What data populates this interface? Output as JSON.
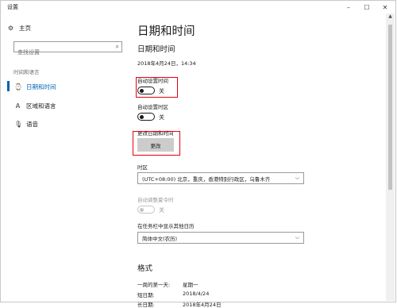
{
  "window": {
    "title": "设置",
    "minimize": "–",
    "maximize": "☐",
    "close": "✕"
  },
  "sidebar": {
    "home_label": "主页",
    "search_placeholder": "查找设置",
    "group_label": "时间和语言",
    "items": [
      {
        "label": "日期和时间",
        "selected": true
      },
      {
        "label": "区域和语言",
        "selected": false
      },
      {
        "label": "语音",
        "selected": false
      }
    ]
  },
  "main": {
    "page_title": "日期和时间",
    "section_title": "日期和时间",
    "current_datetime": "2018年4月24日，14:34",
    "auto_time": {
      "label": "自动设置时间",
      "state_label": "关"
    },
    "auto_timezone": {
      "label": "自动设置时区",
      "state_label": "关"
    },
    "change_datetime": {
      "label": "更改日期和时间",
      "button_label": "更改"
    },
    "timezone": {
      "label": "时区",
      "value": "(UTC+08:00) 北京，重庆，香港特别行政区，乌鲁木齐"
    },
    "dst": {
      "label": "自动调整夏令时",
      "state_label": "关"
    },
    "taskbar_calendar": {
      "label": "在任务栏中显示其他日历",
      "value": "简体中文(农历)"
    },
    "format": {
      "title": "格式",
      "rows": [
        {
          "key": "一周的第一天:",
          "value": "星期一"
        },
        {
          "key": "短日期:",
          "value": "2018/4/24"
        },
        {
          "key": "长日期:",
          "value": "2018年4月24日"
        }
      ]
    }
  },
  "colors": {
    "accent": "#0063b1",
    "highlight": "#e60012"
  }
}
